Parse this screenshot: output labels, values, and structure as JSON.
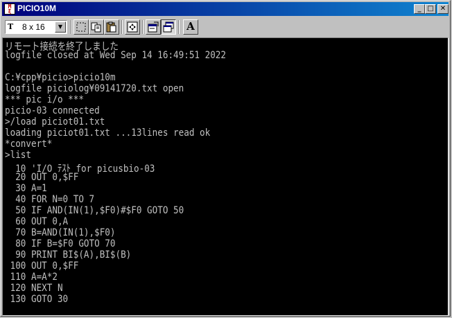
{
  "window": {
    "title": "PICIO10M",
    "minimize_label": "_",
    "maximize_label": "□",
    "close_label": "✕"
  },
  "toolbar": {
    "font_select_value": "8 x 16",
    "font_icon_label": "T",
    "font_button_label": "A"
  },
  "terminal": {
    "lines": [
      "リモート接続を終了しました",
      "logfile closed at Wed Sep 14 16:49:51 2022",
      "",
      "C:¥cpp¥picio>picio10m",
      "logfile piciolog¥09141720.txt open",
      "*** pic i/o ***",
      "picio-03 connected",
      ">/load piciot01.txt",
      "loading piciot01.txt ...13lines read ok",
      "*convert*",
      ">list",
      "  10 'I/O ﾃｽﾄ for picusbio-03",
      "  20 OUT 0,$FF",
      "  30 A=1",
      "  40 FOR N=0 TO 7",
      "  50 IF AND(IN(1),$F0)#$F0 GOTO 50",
      "  60 OUT 0,A",
      "  70 B=AND(IN(1),$F0)",
      "  80 IF B=$F0 GOTO 70",
      "  90 PRINT BI$(A),BI$(B)",
      " 100 OUT 0,$FF",
      " 110 A=A*2",
      " 120 NEXT N",
      " 130 GOTO 30",
      "",
      ">"
    ]
  }
}
